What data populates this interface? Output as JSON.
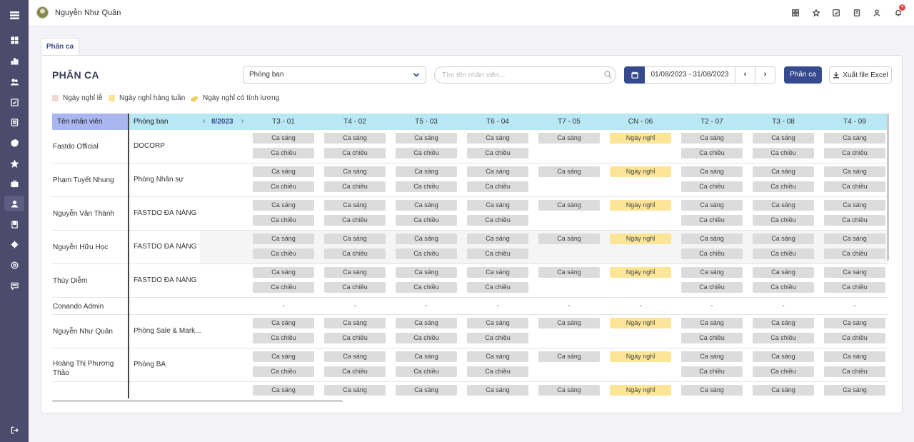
{
  "user": {
    "name": "Nguyễn Như Quân"
  },
  "notifications": {
    "count": "4"
  },
  "sidebar": {
    "icons": [
      "menu-icon",
      "dashboard-icon",
      "chart-icon",
      "users-icon",
      "checklist-icon",
      "report-icon",
      "pie-icon",
      "star-icon",
      "briefcase-icon",
      "employee-icon",
      "document-icon",
      "settings-icon",
      "support-icon",
      "chat-icon",
      "logout-icon"
    ]
  },
  "top_icons": [
    "qr-icon",
    "star-icon",
    "checklist-icon",
    "document-icon",
    "user-icon",
    "bell-icon"
  ],
  "tab": {
    "label": "Phân ca"
  },
  "page": {
    "title": "PHÂN CA"
  },
  "filters": {
    "department_select": "Phòng ban",
    "search_placeholder": "Tìm tên nhân viên...",
    "date_range": "01/08/2023 - 31/08/2023",
    "prev": "‹",
    "next": "›",
    "assign_button": "Phân ca",
    "export_button": "Xuất file Excel"
  },
  "legend": [
    {
      "label": "Ngày nghỉ lễ",
      "color": "#f3d7d7"
    },
    {
      "label": "Ngày nghỉ hàng tuần",
      "color": "#fde598"
    },
    {
      "label": "Ngày nghỉ có tính lương",
      "color": "coin"
    }
  ],
  "table": {
    "col_name": "Tên nhân viên",
    "col_dept": "Phòng ban",
    "month": "8/2023",
    "month_prev": "‹",
    "month_next": "›",
    "days": [
      "T3 - 01",
      "T4 - 02",
      "T5 - 03",
      "T6 - 04",
      "T7 - 05",
      "CN - 06",
      "T2 - 07",
      "T3 - 08",
      "T4 - 09"
    ],
    "shift_morning": "Ca sáng",
    "shift_afternoon": "Ca chiều",
    "day_off": "Ngày nghỉ",
    "empty": "-",
    "rows": [
      {
        "name": "Fastdo Official",
        "dept": "DOCORP"
      },
      {
        "name": "Phạm Tuyết Nhung",
        "dept": "Phòng Nhân sự"
      },
      {
        "name": "Nguyễn Văn Thành",
        "dept": "FASTDO ĐÀ NẴNG"
      },
      {
        "name": "Nguyễn Hữu Học",
        "dept": "FASTDO ĐÀ NẴNG"
      },
      {
        "name": "Thúy Diễm",
        "dept": "FASTDO ĐÀ NẴNG"
      },
      {
        "name": "Conando Admin",
        "dept": ""
      },
      {
        "name": "Nguyễn Như Quân",
        "dept": "Phòng Sale & Mark..."
      },
      {
        "name": "Hoàng Thị Phương Thảo",
        "dept": "Phòng BA"
      },
      {
        "name": "",
        "dept": ""
      }
    ]
  }
}
